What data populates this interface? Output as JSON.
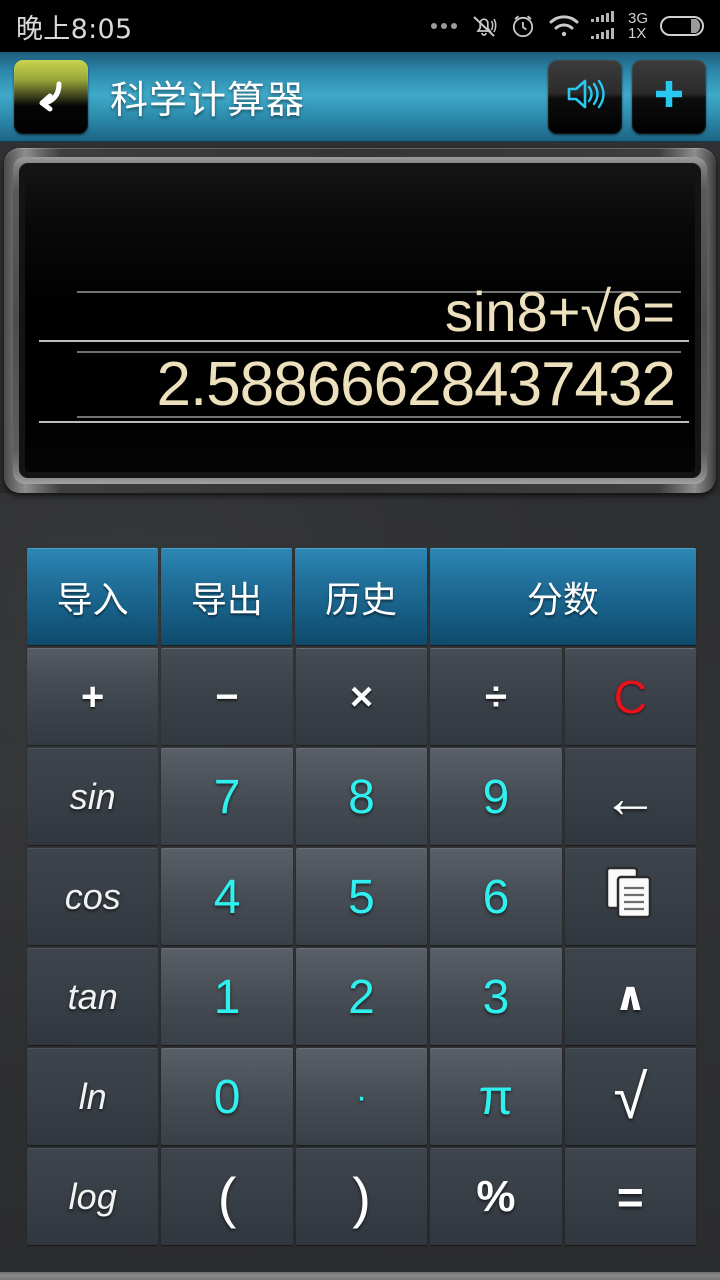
{
  "statusbar": {
    "clock": "晚上8:05",
    "icons": [
      "more-dots-icon",
      "vibrate-off-icon",
      "alarm-clock-icon",
      "wifi-icon",
      "signal-bars-icon",
      "battery-icon"
    ],
    "network_primary": "3G",
    "network_secondary": "1X"
  },
  "titlebar": {
    "back_label": "",
    "title": "科学计算器",
    "sound_label": "",
    "add_label": ""
  },
  "display": {
    "expression": "sin8+√6=",
    "result": "2.58866628437432",
    "text_color": "#ece0bd",
    "background": "#000000"
  },
  "keypad": {
    "accent_blue": "#22739e",
    "number_color": "#2ff0ef",
    "clear_color": "#e8131a",
    "rows": [
      {
        "keys": [
          {
            "label": "导入",
            "name": "key-import",
            "style": "blue",
            "span": 1
          },
          {
            "label": "导出",
            "name": "key-export",
            "style": "blue",
            "span": 1
          },
          {
            "label": "历史",
            "name": "key-history",
            "style": "blue",
            "span": 1
          },
          {
            "label": "分数",
            "name": "key-fraction",
            "style": "blue",
            "span": 2
          }
        ]
      },
      {
        "keys": [
          {
            "label": "+",
            "name": "key-plus",
            "style": "op",
            "span": 1
          },
          {
            "label": "−",
            "name": "key-minus",
            "style": "op-dim",
            "span": 1
          },
          {
            "label": "×",
            "name": "key-multiply",
            "style": "op-dim",
            "span": 1
          },
          {
            "label": "÷",
            "name": "key-divide",
            "style": "op-dim",
            "span": 1
          },
          {
            "label": "C",
            "name": "key-clear",
            "style": "clear",
            "span": 1
          }
        ]
      },
      {
        "keys": [
          {
            "label": "sin",
            "name": "key-sin",
            "style": "fn",
            "span": 1
          },
          {
            "label": "7",
            "name": "key-7",
            "style": "num",
            "span": 1
          },
          {
            "label": "8",
            "name": "key-8",
            "style": "num",
            "span": 1
          },
          {
            "label": "9",
            "name": "key-9",
            "style": "num",
            "span": 1
          },
          {
            "label": "←",
            "name": "key-backspace",
            "style": "util",
            "span": 1
          }
        ]
      },
      {
        "keys": [
          {
            "label": "cos",
            "name": "key-cos",
            "style": "fn",
            "span": 1
          },
          {
            "label": "4",
            "name": "key-4",
            "style": "num",
            "span": 1
          },
          {
            "label": "5",
            "name": "key-5",
            "style": "num",
            "span": 1
          },
          {
            "label": "6",
            "name": "key-6",
            "style": "num",
            "span": 1
          },
          {
            "label": "",
            "name": "key-copy",
            "style": "icon-copy",
            "span": 1
          }
        ]
      },
      {
        "keys": [
          {
            "label": "tan",
            "name": "key-tan",
            "style": "fn",
            "span": 1
          },
          {
            "label": "1",
            "name": "key-1",
            "style": "num",
            "span": 1
          },
          {
            "label": "2",
            "name": "key-2",
            "style": "num",
            "span": 1
          },
          {
            "label": "3",
            "name": "key-3",
            "style": "num",
            "span": 1
          },
          {
            "label": "∧",
            "name": "key-power",
            "style": "util",
            "span": 1
          }
        ]
      },
      {
        "keys": [
          {
            "label": "ln",
            "name": "key-ln",
            "style": "fn",
            "span": 1
          },
          {
            "label": "0",
            "name": "key-0",
            "style": "num",
            "span": 1
          },
          {
            "label": "·",
            "name": "key-decimal",
            "style": "num-dot",
            "span": 1
          },
          {
            "label": "π",
            "name": "key-pi",
            "style": "num-pi",
            "span": 1
          },
          {
            "label": "√",
            "name": "key-sqrt",
            "style": "util-sqrt",
            "span": 1
          }
        ]
      },
      {
        "keys": [
          {
            "label": "log",
            "name": "key-log",
            "style": "fn",
            "span": 1
          },
          {
            "label": "(",
            "name": "key-paren-open",
            "style": "util",
            "span": 1
          },
          {
            "label": ")",
            "name": "key-paren-close",
            "style": "util",
            "span": 1
          },
          {
            "label": "%",
            "name": "key-percent",
            "style": "util",
            "span": 1
          },
          {
            "label": "=",
            "name": "key-equals",
            "style": "util",
            "span": 1
          }
        ]
      }
    ]
  }
}
